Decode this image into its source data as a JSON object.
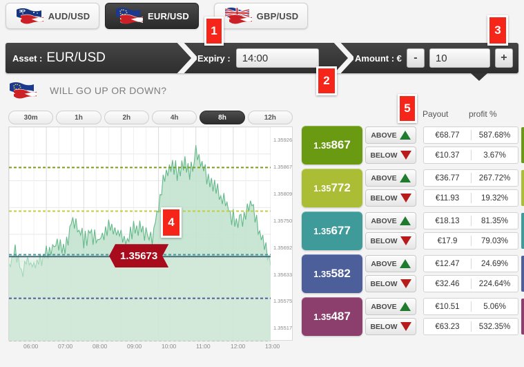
{
  "tabs": [
    {
      "label": "AUD/USD",
      "flag": "aud-usd-flag-icon",
      "active": false
    },
    {
      "label": "EUR/USD",
      "flag": "eur-usd-flag-icon",
      "active": true
    },
    {
      "label": "GBP/USD",
      "flag": "gbp-usd-flag-icon",
      "active": false
    }
  ],
  "assetbar": {
    "asset_label": "Asset :",
    "asset_value": "EUR/USD",
    "expiry_label": "Expiry :",
    "expiry_value": "14:00",
    "amount_label": "Amount : €",
    "amount_minus": "-",
    "amount_value": "10",
    "amount_plus": "+"
  },
  "panel": {
    "question": "WILL GO UP OR DOWN?",
    "flag": "eur-usd-flag-icon"
  },
  "timeframes": [
    {
      "label": "30m",
      "active": false
    },
    {
      "label": "1h",
      "active": false
    },
    {
      "label": "2h",
      "active": false
    },
    {
      "label": "4h",
      "active": false
    },
    {
      "label": "8h",
      "active": true
    },
    {
      "label": "12h",
      "active": false
    }
  ],
  "table": {
    "head_payout": "Payout",
    "head_profit": "profit %",
    "above_label": "ABOVE",
    "below_label": "BELOW"
  },
  "rows": [
    {
      "strike_prefix": "1.35",
      "strike_suffix": "867",
      "color": "#6a9a12",
      "above": {
        "payout": "€68.77",
        "profit": "587.68%"
      },
      "below": {
        "payout": "€10.37",
        "profit": "3.67%"
      }
    },
    {
      "strike_prefix": "1.35",
      "strike_suffix": "772",
      "color": "#aabd34",
      "above": {
        "payout": "€36.77",
        "profit": "267.72%"
      },
      "below": {
        "payout": "€11.93",
        "profit": "19.32%"
      }
    },
    {
      "strike_prefix": "1.35",
      "strike_suffix": "677",
      "color": "#3f9a9a",
      "above": {
        "payout": "€18.13",
        "profit": "81.35%"
      },
      "below": {
        "payout": "€17.9",
        "profit": "79.03%"
      }
    },
    {
      "strike_prefix": "1.35",
      "strike_suffix": "582",
      "color": "#4c5f9b",
      "above": {
        "payout": "€12.47",
        "profit": "24.69%"
      },
      "below": {
        "payout": "€32.46",
        "profit": "224.64%"
      }
    },
    {
      "strike_prefix": "1.35",
      "strike_suffix": "487",
      "color": "#8c3f6c",
      "above": {
        "payout": "€10.51",
        "profit": "5.06%"
      },
      "below": {
        "payout": "€63.23",
        "profit": "532.35%"
      }
    }
  ],
  "callouts": [
    {
      "num": "1"
    },
    {
      "num": "2"
    },
    {
      "num": "3"
    },
    {
      "num": "4"
    },
    {
      "num": "5"
    }
  ],
  "chart_data": {
    "type": "area",
    "title": "",
    "xlabel": "",
    "ylabel": "",
    "current_price": "1.35673",
    "price_badge": "1.35673",
    "xtick_labels": [
      "06:00",
      "07:00",
      "08:00",
      "09:00",
      "10:00",
      "11:00",
      "12:00",
      "13:00"
    ],
    "ytick_labels": [
      "1.35926",
      "1.35867",
      "1.35809",
      "1.35750",
      "1.35692",
      "1.35633",
      "1.35575",
      "1.35517"
    ],
    "ylim": [
      1.35488,
      1.35955
    ],
    "grid": true,
    "legend": "none",
    "series_color": "#63b98a",
    "fill_color": "#bfe0cd",
    "strike_lines": [
      {
        "value": 1.35867,
        "color": "#7d9c18",
        "style": "dashed"
      },
      {
        "value": 1.35772,
        "color": "#c2ce3e",
        "style": "dashed"
      },
      {
        "value": 1.35677,
        "color": "#3f9a9a",
        "style": "dashed"
      },
      {
        "value": 1.35582,
        "color": "#4c5f9b",
        "style": "dashed"
      },
      {
        "value": 1.35487,
        "color": "#8c3f6c",
        "style": "dashed"
      }
    ],
    "x": [
      "06:00",
      "06:10",
      "06:20",
      "06:30",
      "06:40",
      "06:50",
      "07:00",
      "07:10",
      "07:20",
      "07:30",
      "07:40",
      "07:50",
      "08:00",
      "08:10",
      "08:20",
      "08:30",
      "08:40",
      "08:50",
      "09:00",
      "09:10",
      "09:20",
      "09:30",
      "09:40",
      "09:50",
      "10:00",
      "10:10",
      "10:20",
      "10:30",
      "10:40",
      "10:50",
      "11:00",
      "11:10",
      "11:20",
      "11:30",
      "11:40",
      "11:50",
      "12:00",
      "12:10",
      "12:20",
      "12:30",
      "12:40",
      "12:50",
      "13:00"
    ],
    "values": [
      1.35668,
      1.3569,
      1.35655,
      1.35672,
      1.35663,
      1.3568,
      1.35694,
      1.35706,
      1.35712,
      1.357,
      1.35756,
      1.35742,
      1.3572,
      1.35735,
      1.35718,
      1.35726,
      1.35744,
      1.35738,
      1.35728,
      1.35716,
      1.35745,
      1.3575,
      1.35733,
      1.35722,
      1.358,
      1.35862,
      1.3588,
      1.35871,
      1.3589,
      1.35864,
      1.35905,
      1.35876,
      1.35858,
      1.35842,
      1.35812,
      1.3579,
      1.35766,
      1.35754,
      1.35776,
      1.358,
      1.35742,
      1.357,
      1.35676
    ]
  }
}
